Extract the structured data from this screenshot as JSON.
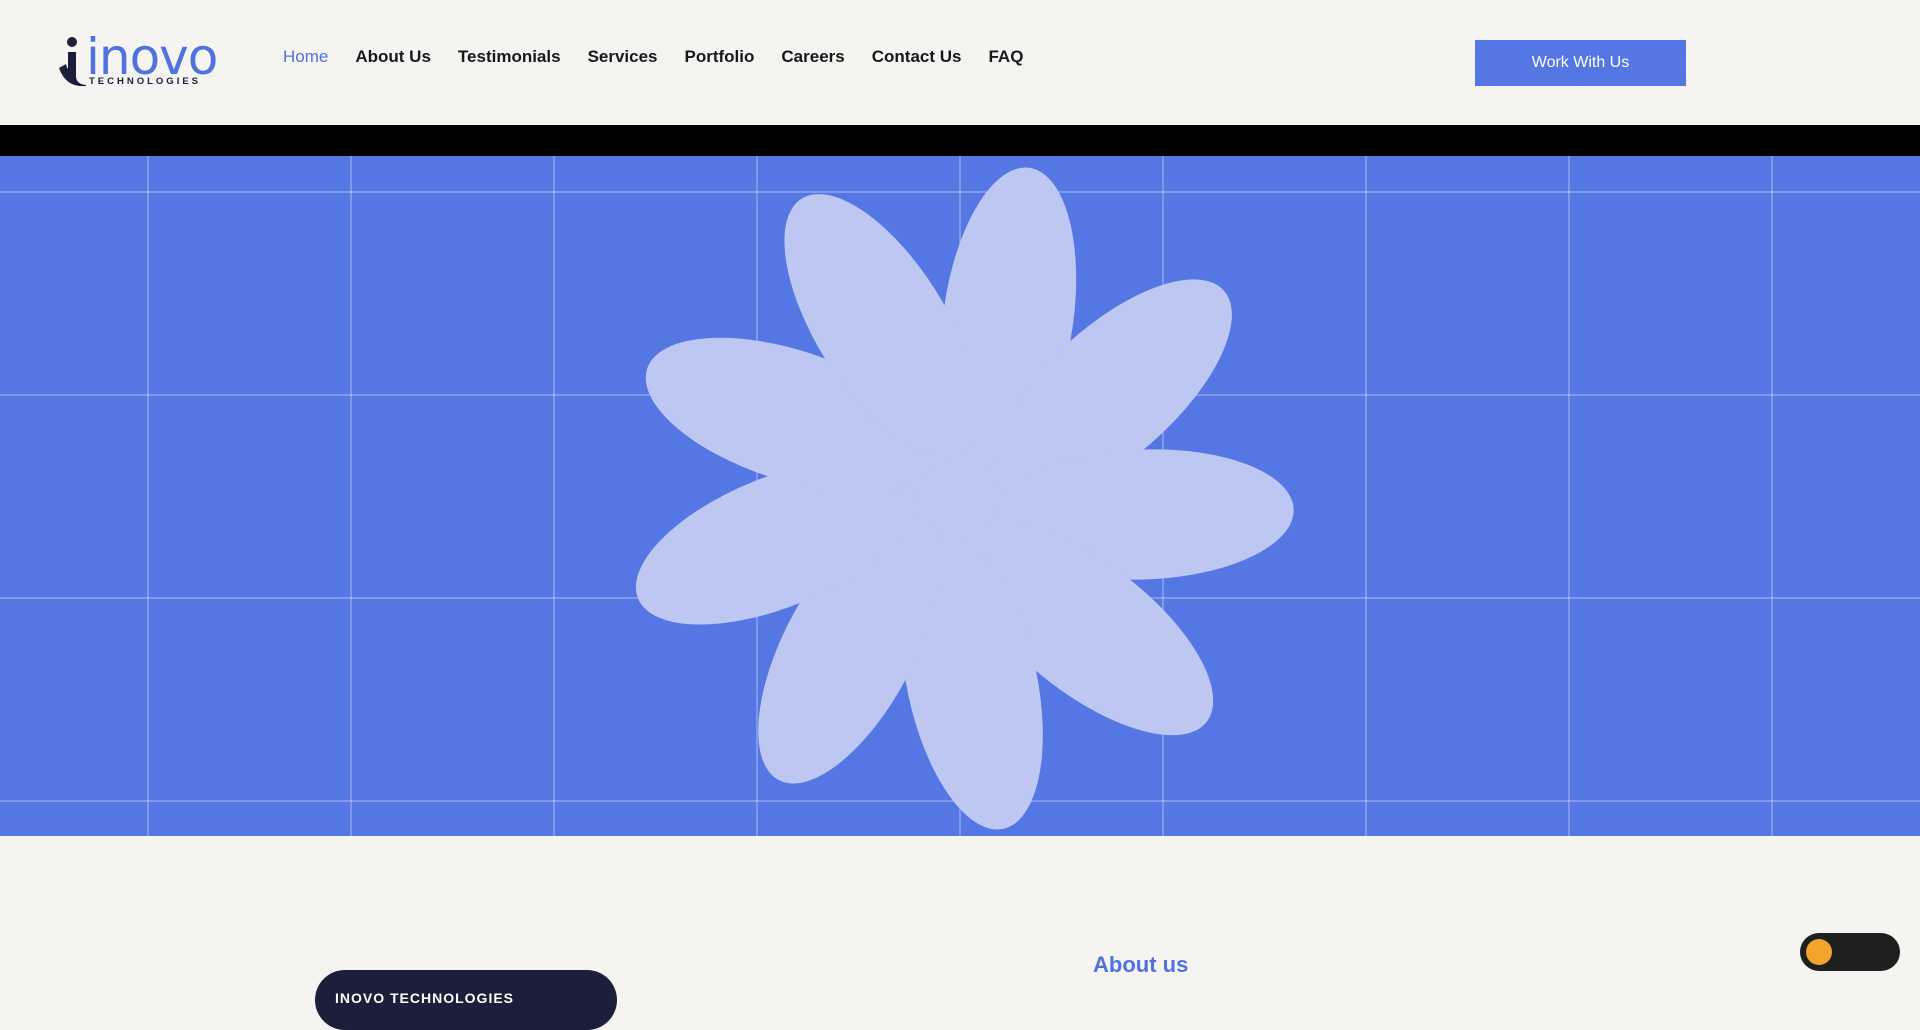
{
  "brand": {
    "name": "inovo",
    "subtitle": "TECHNOLOGIES"
  },
  "nav": {
    "items": [
      {
        "label": "Home",
        "active": true
      },
      {
        "label": "About Us",
        "active": false
      },
      {
        "label": "Testimonials",
        "active": false
      },
      {
        "label": "Services",
        "active": false
      },
      {
        "label": "Portfolio",
        "active": false
      },
      {
        "label": "Careers",
        "active": false
      },
      {
        "label": "Contact Us",
        "active": false
      },
      {
        "label": "FAQ",
        "active": false
      }
    ]
  },
  "header": {
    "cta_label": "Work With Us"
  },
  "hero": {
    "graphic": "flower-graphic"
  },
  "about": {
    "pill_label": "INOVO TECHNOLOGIES",
    "title": "About us"
  },
  "colors": {
    "accent": "#5577e3",
    "brand_dark": "#1c1f3c",
    "flower": "#bdc7f2",
    "background": "#f6f4f0",
    "toggle_knob": "#f3a42a"
  }
}
